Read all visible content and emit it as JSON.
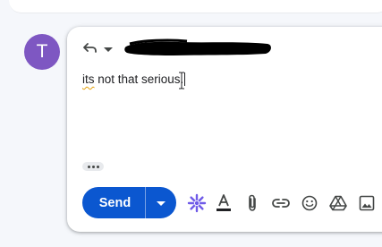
{
  "avatar": {
    "initial": "T",
    "color": "#7e57c2"
  },
  "compose": {
    "reply_type_icon": "reply-icon",
    "recipients_redacted": true,
    "body": {
      "misspelled_word": "its",
      "rest_text": " not that serious."
    },
    "show_trimmed_icon": "more-horiz-icon"
  },
  "send": {
    "label": "Send",
    "color": "#0b57d0",
    "more_options_icon": "arrow-drop-down-icon"
  },
  "toolbar": {
    "icons": [
      "ai-help-me-write-icon",
      "text-formatting-icon",
      "attach-icon",
      "link-icon",
      "emoji-icon",
      "drive-icon",
      "photo-icon"
    ],
    "ai_color": "#6f5ae8",
    "icon_color": "#444746"
  }
}
